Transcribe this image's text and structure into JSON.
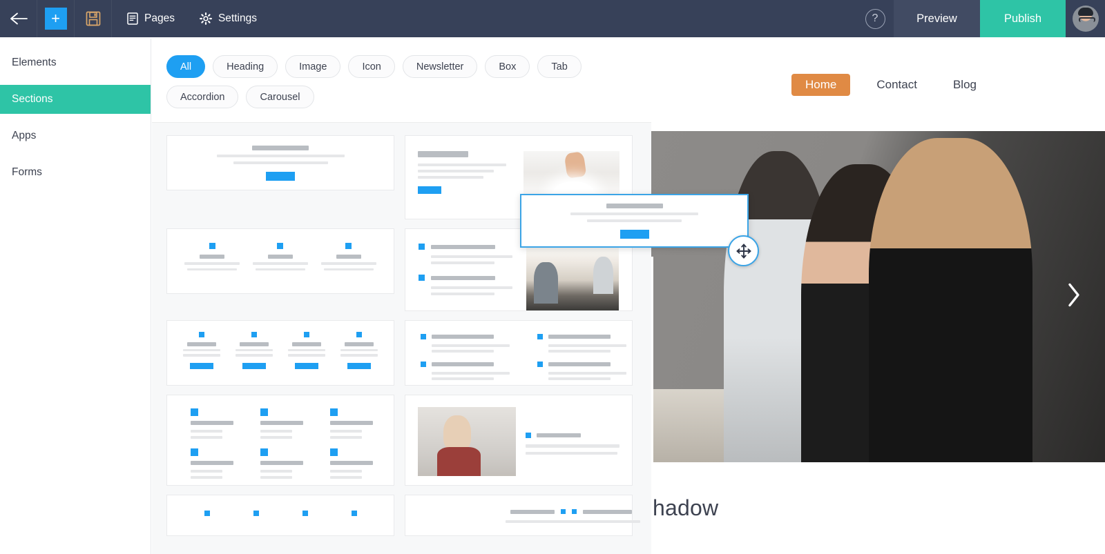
{
  "topbar": {
    "back_icon": "arrow-left-icon",
    "add_icon": "plus-icon",
    "add_label": "+",
    "save_icon": "floppy-disk-save-icon",
    "pages_icon": "page-icon",
    "pages_label": "Pages",
    "settings_icon": "gear-icon",
    "settings_label": "Settings",
    "help_icon": "question-mark-icon",
    "help_label": "?",
    "preview_label": "Preview",
    "publish_label": "Publish",
    "avatar_name": "user-avatar",
    "bg_color": "#374159",
    "publish_color": "#2ec4a6",
    "add_color": "#1e9ff2"
  },
  "sidebar": {
    "items": [
      {
        "label": "Elements",
        "active": false
      },
      {
        "label": "Sections",
        "active": true
      },
      {
        "label": "Apps",
        "active": false
      },
      {
        "label": "Forms",
        "active": false
      }
    ],
    "active_color": "#2ec4a6"
  },
  "panel": {
    "filters": [
      {
        "label": "All",
        "active": true
      },
      {
        "label": "Heading",
        "active": false
      },
      {
        "label": "Image",
        "active": false
      },
      {
        "label": "Icon",
        "active": false
      },
      {
        "label": "Newsletter",
        "active": false
      },
      {
        "label": "Box",
        "active": false
      },
      {
        "label": "Tab",
        "active": false
      },
      {
        "label": "Accordion",
        "active": false
      },
      {
        "label": "Carousel",
        "active": false
      }
    ],
    "active_filter_color": "#1e9ff2",
    "templates": [
      {
        "name": "centered-heading-with-button",
        "kind": "centered-cta"
      },
      {
        "name": "text-left-image-right",
        "kind": "text-image"
      },
      {
        "name": "three-column-icon-features",
        "kind": "three-icons"
      },
      {
        "name": "bullet-list-with-image",
        "kind": "list-image"
      },
      {
        "name": "four-column-icon-cta",
        "kind": "four-icons-cta"
      },
      {
        "name": "two-column-bullet-list",
        "kind": "two-col-bullets"
      },
      {
        "name": "six-item-icon-grid",
        "kind": "six-icon-grid"
      },
      {
        "name": "image-left-text-right",
        "kind": "image-text"
      },
      {
        "name": "four-column-icons-partial",
        "kind": "four-icons-partial"
      },
      {
        "name": "split-heading-partial",
        "kind": "split-heading-partial"
      }
    ]
  },
  "preview": {
    "nav_links": [
      {
        "label": "Home",
        "active": true
      },
      {
        "label": "Contact",
        "active": false
      },
      {
        "label": "Blog",
        "active": false
      }
    ],
    "nav_active_color": "#e08a44",
    "carousel_next_icon": "chevron-right-icon",
    "heading_partial": "hadow",
    "hero_image_name": "classroom-students-photo"
  },
  "drag": {
    "ghost_name": "dragged-section-ghost",
    "handle_icon": "move-arrows-icon",
    "accent_color": "#3ba4e6"
  }
}
